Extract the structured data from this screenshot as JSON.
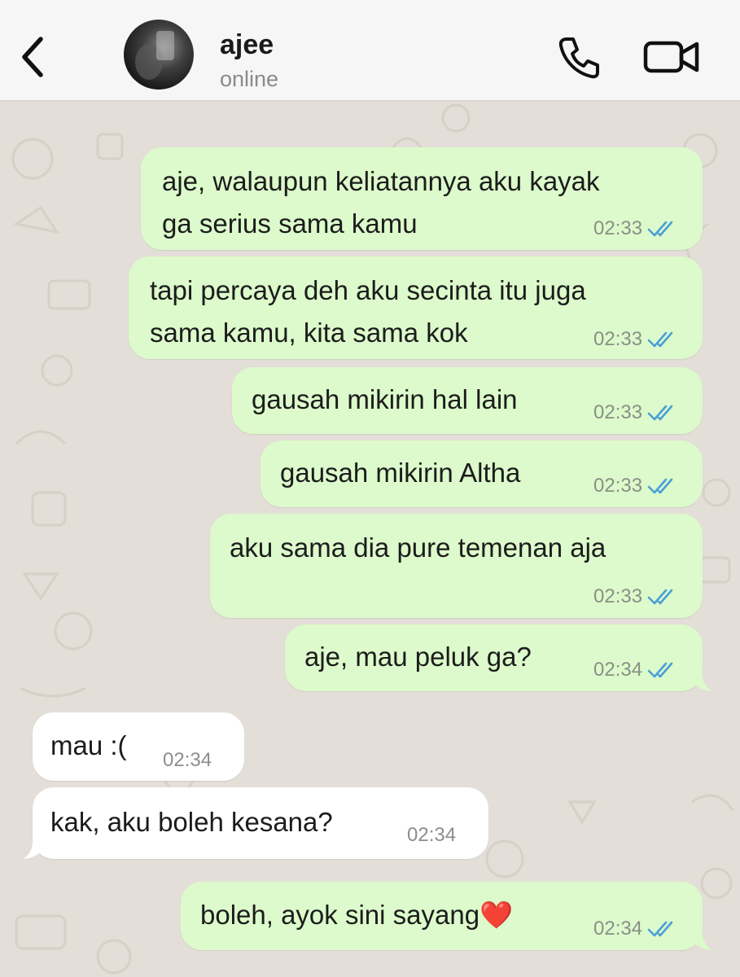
{
  "header": {
    "contact_name": "ajee",
    "status": "online"
  },
  "colors": {
    "outgoing_bubble": "#dcfacb",
    "incoming_bubble": "#ffffff",
    "read_ticks": "#4a9fd8",
    "chat_background": "#e3ded7"
  },
  "icons": {
    "back": "chevron-left-icon",
    "call": "phone-icon",
    "video": "video-camera-icon",
    "read_status": "double-check-icon"
  },
  "messages": [
    {
      "direction": "out",
      "text_lines": [
        "aje, walaupun keliatannya aku kayak",
        "ga serius sama kamu"
      ],
      "time": "02:33",
      "read": true
    },
    {
      "direction": "out",
      "text_lines": [
        "tapi percaya deh aku secinta itu juga",
        "sama kamu, kita sama kok"
      ],
      "time": "02:33",
      "read": true
    },
    {
      "direction": "out",
      "text_lines": [
        "gausah mikirin hal lain"
      ],
      "time": "02:33",
      "read": true
    },
    {
      "direction": "out",
      "text_lines": [
        "gausah mikirin Altha"
      ],
      "time": "02:33",
      "read": true
    },
    {
      "direction": "out",
      "text_lines": [
        "aku sama dia pure temenan aja"
      ],
      "time": "02:33",
      "read": true
    },
    {
      "direction": "out",
      "text_lines": [
        "aje, mau peluk ga?"
      ],
      "time": "02:34",
      "read": true
    },
    {
      "direction": "in",
      "text_lines": [
        "mau :("
      ],
      "time": "02:34"
    },
    {
      "direction": "in",
      "text_lines": [
        "kak, aku boleh kesana?"
      ],
      "time": "02:34"
    },
    {
      "direction": "out",
      "text_lines": [
        "boleh, ayok sini sayang❤️"
      ],
      "time": "02:34",
      "read": true
    }
  ]
}
